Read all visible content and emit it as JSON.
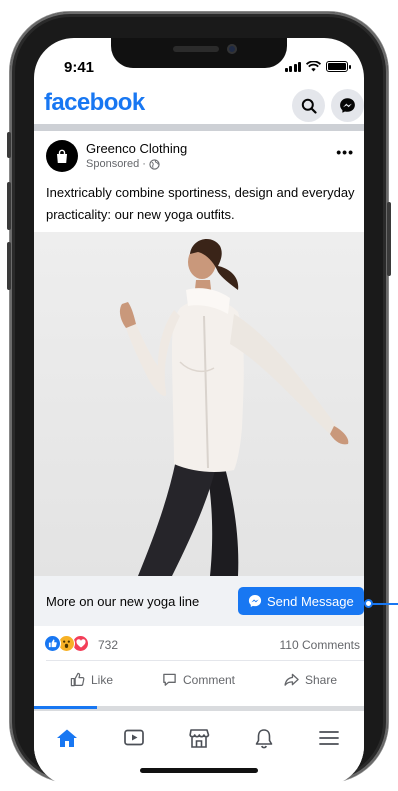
{
  "status_bar": {
    "time": "9:41"
  },
  "header": {
    "logo": "facebook",
    "search_icon": "search-icon",
    "messenger_icon": "messenger-icon",
    "brand_color": "#1877f2"
  },
  "post": {
    "page_name": "Greenco Clothing",
    "sponsored_label": "Sponsored ·",
    "more_label": "•••",
    "text": "Inextricably combine sportiness, design and everyday practicality: our new yoga outfits.",
    "cta_text": "More on our new yoga line",
    "cta_button": "Send Message",
    "reaction_count": "732",
    "comments_count": "110 Comments",
    "actions": {
      "like": "Like",
      "comment": "Comment",
      "share": "Share"
    }
  },
  "tabbar": {
    "items": [
      "home-icon",
      "watch-icon",
      "marketplace-icon",
      "notifications-icon",
      "menu-icon"
    ],
    "active": "home-icon"
  }
}
